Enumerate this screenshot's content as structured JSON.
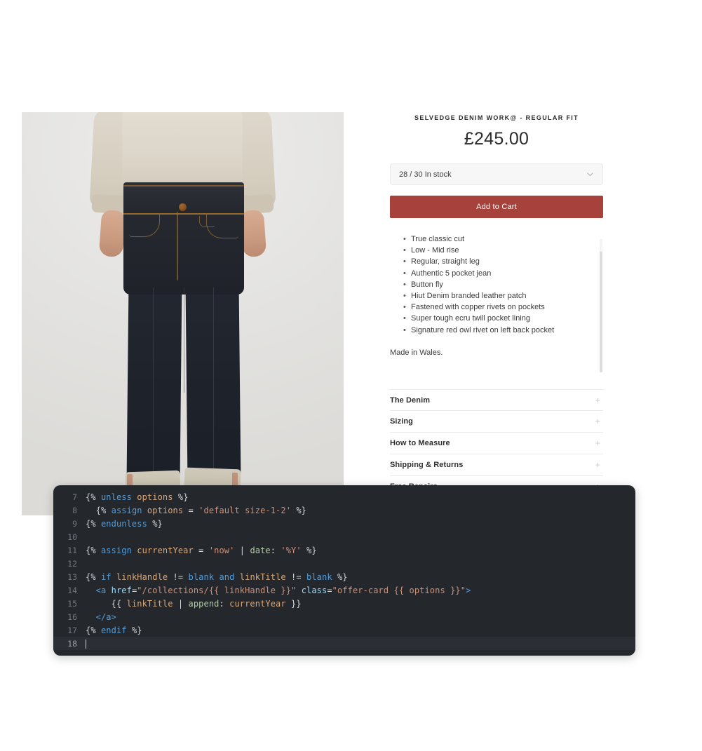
{
  "product": {
    "title": "SELVEDGE DENIM WORK@ - REGULAR FIT",
    "price": "£245.00",
    "variant_selected": "28 / 30 In stock",
    "add_to_cart_label": "Add to Cart",
    "features": [
      "True classic cut",
      "Low - Mid rise",
      "Regular, straight leg",
      "Authentic 5 pocket jean",
      "Button fly",
      "Hiut Denim branded leather patch",
      "Fastened with copper rivets on pockets",
      "Super tough ecru twill pocket lining",
      "Signature red owl rivet on left back pocket"
    ],
    "made_in": "Made in Wales.",
    "accordion": [
      {
        "label": "The Denim",
        "toggle": "+"
      },
      {
        "label": "Sizing",
        "toggle": "+"
      },
      {
        "label": "How to Measure",
        "toggle": "+"
      },
      {
        "label": "Shipping & Returns",
        "toggle": "+"
      },
      {
        "label": "Free Repairs",
        "toggle": "+"
      }
    ],
    "colors": {
      "add_to_cart_bg": "#a6413c",
      "select_bg": "#f7f7f7",
      "text": "#2f2f2f"
    }
  },
  "code_editor": {
    "background": "#24272c",
    "active_line": 18,
    "lines": [
      {
        "n": "7",
        "text": "{% unless options %}"
      },
      {
        "n": "8",
        "text": "  {% assign options = 'default size-1-2' %}"
      },
      {
        "n": "9",
        "text": "{% endunless %}"
      },
      {
        "n": "10",
        "text": ""
      },
      {
        "n": "11",
        "text": "{% assign currentYear = 'now' | date: '%Y' %}"
      },
      {
        "n": "12",
        "text": ""
      },
      {
        "n": "13",
        "text": "{% if linkHandle != blank and linkTitle != blank %}"
      },
      {
        "n": "14",
        "text": "  <a href=\"/collections/{{ linkHandle }}\" class=\"offer-card {{ options }}\">"
      },
      {
        "n": "15",
        "text": "     {{ linkTitle | append: currentYear }}"
      },
      {
        "n": "16",
        "text": "  </a>"
      },
      {
        "n": "17",
        "text": "{% endif %}"
      },
      {
        "n": "18",
        "text": ""
      }
    ]
  }
}
